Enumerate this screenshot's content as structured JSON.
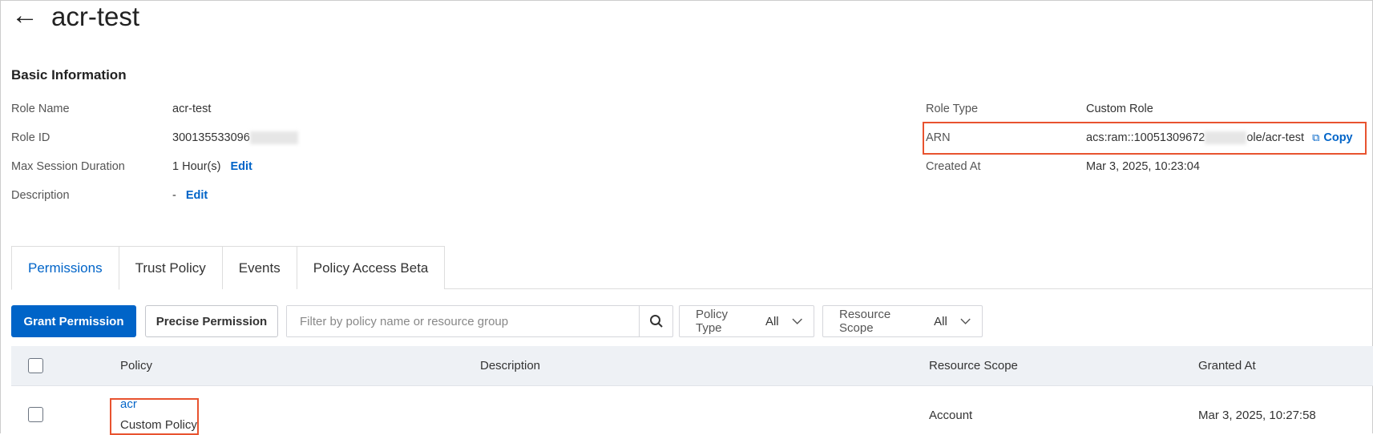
{
  "header": {
    "back_icon": "arrow-left-icon",
    "title": "acr-test"
  },
  "basic_info": {
    "heading": "Basic Information",
    "role_name_label": "Role Name",
    "role_name": "acr-test",
    "role_id_label": "Role ID",
    "role_id": "300135533096",
    "max_session_label": "Max Session Duration",
    "max_session": "1 Hour(s)",
    "edit_label": "Edit",
    "description_label": "Description",
    "description": "-",
    "role_type_label": "Role Type",
    "role_type": "Custom Role",
    "arn_label": "ARN",
    "arn_prefix": "acs:ram::10051309672",
    "arn_suffix": "ole/acr-test",
    "copy_label": "Copy",
    "created_label": "Created At",
    "created": "Mar 3, 2025, 10:23:04"
  },
  "tabs": [
    {
      "label": "Permissions"
    },
    {
      "label": "Trust Policy"
    },
    {
      "label": "Events"
    },
    {
      "label": "Policy Access Beta"
    }
  ],
  "toolbar": {
    "grant_label": "Grant Permission",
    "precise_label": "Precise Permission",
    "search_placeholder": "Filter by policy name or resource group",
    "policy_type_label": "Policy Type",
    "policy_type_value": "All",
    "resource_scope_label": "Resource Scope",
    "resource_scope_value": "All"
  },
  "table": {
    "columns": [
      "Policy",
      "Description",
      "Resource Scope",
      "Granted At"
    ],
    "rows": [
      {
        "policy": "acr",
        "policy_type": "Custom Policy",
        "description": "",
        "scope": "Account",
        "granted": "Mar 3, 2025, 10:27:58"
      }
    ]
  },
  "colors": {
    "accent": "#0064c8",
    "highlight": "#e8532f"
  }
}
